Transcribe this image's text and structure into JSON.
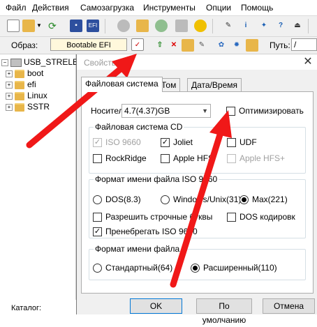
{
  "menu": [
    "Файл",
    "Действия",
    "Самозагрузка",
    "Инструменты",
    "Опции",
    "Помощь"
  ],
  "toolbar": {
    "icons": [
      "new-icon",
      "open-icon",
      "dropdown-arrow-icon",
      "refresh-icon",
      "save-icon",
      "efi-icon",
      "burn-icon",
      "mount-icon",
      "extract-icon",
      "virtual-drive-icon",
      "settings-icon",
      "properties-icon",
      "info-icon",
      "network-icon",
      "help-icon",
      "exit-icon"
    ]
  },
  "image_row": {
    "label": "Образ:",
    "value": "Bootable EFI",
    "path_label": "Путь:",
    "path_value": "/"
  },
  "tree": {
    "root": "USB_STRELEC",
    "folders": [
      "boot",
      "efi",
      "Linux",
      "SSTR"
    ]
  },
  "status": {
    "catalog_label": "Каталог:"
  },
  "dialog": {
    "title": "Свойства",
    "close": "✕",
    "tabs": [
      "Файловая система",
      "Том",
      "Дата/Время"
    ],
    "active_tab": "Файловая система",
    "carrier_label": "Носитель:",
    "carrier_value": "4.7(4.37)GB",
    "optimize_label": "Оптимизировать",
    "optimize_checked": false,
    "fs_group": {
      "title": "Файловая система CD",
      "options": [
        {
          "label": "ISO 9660",
          "checked": true,
          "disabled": true
        },
        {
          "label": "Joliet",
          "checked": true,
          "disabled": false
        },
        {
          "label": "UDF",
          "checked": false,
          "disabled": false
        },
        {
          "label": "RockRidge",
          "checked": false,
          "disabled": false
        },
        {
          "label": "Apple HFS",
          "checked": false,
          "disabled": false
        },
        {
          "label": "Apple HFS+",
          "checked": false,
          "disabled": true
        }
      ]
    },
    "iso_name_group": {
      "title": "Формат имени файла ISO 9660",
      "radios": [
        {
          "label": "DOS(8.3)",
          "selected": false
        },
        {
          "label": "Windows/Unix(31)",
          "selected": false
        },
        {
          "label": "Max(221)",
          "selected": true
        }
      ],
      "allow_lowercase": {
        "label": "Разрешить строчные буквы",
        "checked": false
      },
      "dos_encoding": {
        "label": "DOS кодировк",
        "checked": false
      },
      "ignore_iso": {
        "label": "Пренебрегать ISO 9660",
        "checked": true
      }
    },
    "name_format_group": {
      "title": "Формат имени файла",
      "radios": [
        {
          "label": "Стандартный(64)",
          "selected": false
        },
        {
          "label": "Расширенный(110)",
          "selected": true
        }
      ]
    },
    "buttons": {
      "ok": "OK",
      "default": "По умолчанию",
      "cancel": "Отмена"
    }
  },
  "colors": {
    "arrow": "#f01818",
    "image_field_bg": "#fff8dc",
    "accent": "#0078d7"
  }
}
